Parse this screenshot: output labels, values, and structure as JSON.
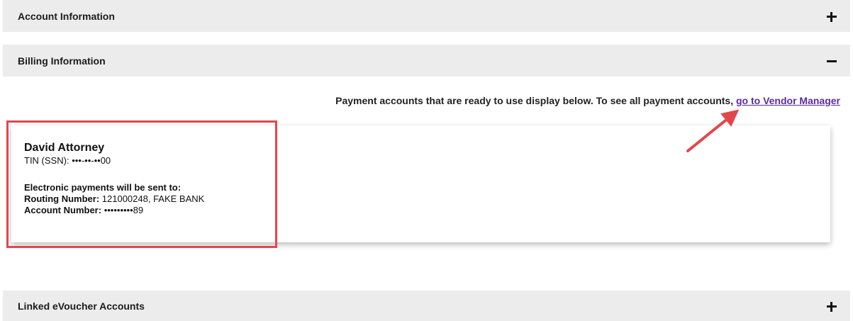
{
  "sections": {
    "account_info": {
      "title": "Account Information",
      "toggle_icon": "plus-icon",
      "expanded": false
    },
    "billing_info": {
      "title": "Billing Information",
      "toggle_icon": "minus-icon",
      "expanded": true
    },
    "linked_evoucher": {
      "title": "Linked eVoucher Accounts",
      "toggle_icon": "plus-icon",
      "expanded": false
    }
  },
  "billing": {
    "notice_text": "Payment accounts that are ready to use display below. To see all payment accounts, ",
    "vendor_manager_link": "go to Vendor Manager",
    "account": {
      "name": "David Attorney",
      "tin_label": "TIN (SSN):",
      "tin_value": "•••-••-••00",
      "payments_heading": "Electronic payments will be sent to:",
      "routing_label": "Routing Number:",
      "routing_value": "121000248, FAKE BANK",
      "account_label": "Account Number:",
      "account_value": "•••••••••89"
    }
  },
  "annotations": {
    "highlight_color": "#e0474c",
    "link_color": "#5a2ca0"
  }
}
